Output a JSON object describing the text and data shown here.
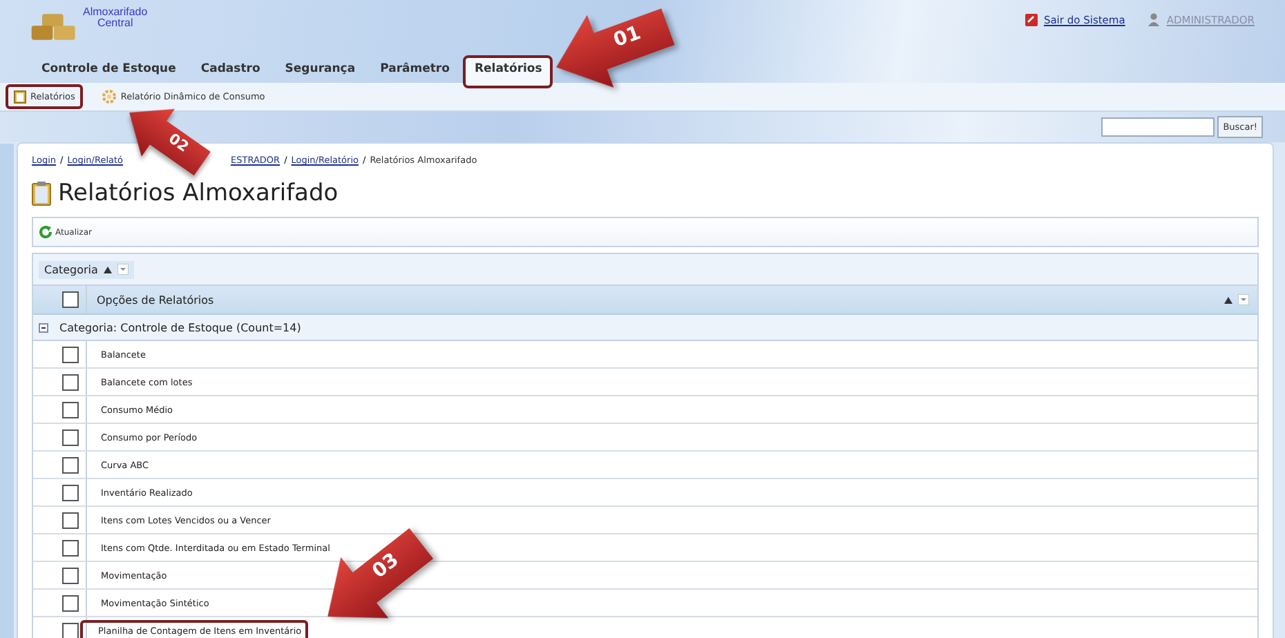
{
  "app": {
    "title_line_1": "Almoxarifado",
    "title_line_2": "Central"
  },
  "user_links": [
    {
      "label": "Sair do Sistema",
      "kind": "logout"
    },
    {
      "label": "ADMINISTRADOR",
      "kind": "user"
    }
  ],
  "tabs": [
    {
      "label": "Controle de Estoque",
      "selected": false,
      "highlighted": false
    },
    {
      "label": "Cadastro",
      "selected": false,
      "highlighted": false
    },
    {
      "label": "Segurança",
      "selected": false,
      "highlighted": false
    },
    {
      "label": "Parâmetro",
      "selected": false,
      "highlighted": false
    },
    {
      "label": "Relatórios",
      "selected": true,
      "highlighted": true
    }
  ],
  "subnav": [
    {
      "label": "Relatórios",
      "kind": "report",
      "highlighted": true
    },
    {
      "label": "Relatório Dinâmico de Consumo",
      "kind": "gear",
      "highlighted": false
    }
  ],
  "search": {
    "button": "Buscar!"
  },
  "breadcrumb_separator": "/",
  "breadcrumb": [
    {
      "label": "Login",
      "link": true
    },
    {
      "label": "Login/Relató",
      "link": true
    },
    {
      "label": "ESTRADOR",
      "link": true
    },
    {
      "label": "Login/Relatório",
      "link": true
    },
    {
      "label": "Relatórios Almoxarifado",
      "link": false
    }
  ],
  "page_title": "Relatórios Almoxarifado",
  "toolbar": {
    "button": "Atualizar"
  },
  "group_panel": {
    "label": "Categoria"
  },
  "grid": {
    "column": "Opções de Relatórios",
    "select_all_checked": false,
    "group": {
      "label": "Categoria: Controle de Estoque (Count=14)",
      "expanded": true
    },
    "rows": [
      {
        "label": "Balancete",
        "checked": false,
        "highlighted": false
      },
      {
        "label": "Balancete com lotes",
        "checked": false,
        "highlighted": false
      },
      {
        "label": "Consumo Médio",
        "checked": false,
        "highlighted": false
      },
      {
        "label": "Consumo por Período",
        "checked": false,
        "highlighted": false
      },
      {
        "label": "Curva ABC",
        "checked": false,
        "highlighted": false
      },
      {
        "label": "Inventário Realizado",
        "checked": false,
        "highlighted": false
      },
      {
        "label": "Itens com Lotes Vencidos ou a Vencer",
        "checked": false,
        "highlighted": false
      },
      {
        "label": "Itens com Qtde. Interditada ou em Estado Terminal",
        "checked": false,
        "highlighted": false
      },
      {
        "label": "Movimentação",
        "checked": false,
        "highlighted": false
      },
      {
        "label": "Movimentação Sintético",
        "checked": false,
        "highlighted": false
      },
      {
        "label": "Planilha de Contagem de Itens em Inventário",
        "checked": false,
        "highlighted": true
      }
    ]
  },
  "callouts": [
    {
      "label": "01"
    },
    {
      "label": "02"
    },
    {
      "label": "03"
    }
  ]
}
